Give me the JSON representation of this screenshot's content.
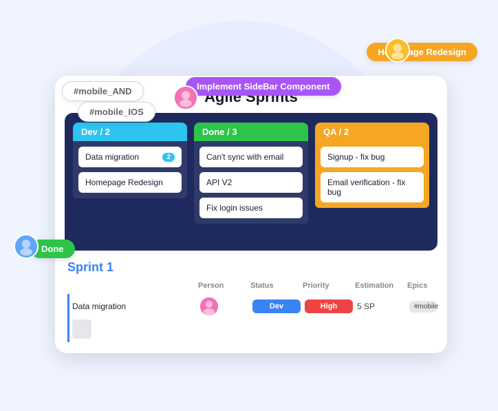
{
  "page": {
    "title": "Agile Sprints"
  },
  "floating_labels": {
    "mobile_and": "#mobile_AND",
    "mobile_ios": "#mobile_IOS",
    "homepage": "Homepage Redesign",
    "sidebar": "Implement SideBar Component",
    "done": "Done"
  },
  "board": {
    "columns": [
      {
        "id": "dev",
        "header": "Dev / 2",
        "type": "dev",
        "cards": [
          {
            "text": "Data migration",
            "badge": "2"
          },
          {
            "text": "Homepage Redesign",
            "badge": null
          }
        ]
      },
      {
        "id": "done",
        "header": "Done / 3",
        "type": "done",
        "cards": [
          {
            "text": "Can't sync with email",
            "badge": null
          },
          {
            "text": "API V2",
            "badge": null
          },
          {
            "text": "Fix login issues",
            "badge": null
          }
        ]
      },
      {
        "id": "qa",
        "header": "QA / 2",
        "type": "qa",
        "cards": [
          {
            "text": "Signup - fix bug",
            "badge": null
          },
          {
            "text": "Email verification - fix bug",
            "badge": null
          }
        ]
      }
    ]
  },
  "sprint": {
    "title": "Sprint 1",
    "headers": [
      "",
      "Person",
      "Status",
      "Priority",
      "Estimation",
      "Epics",
      ""
    ],
    "rows": [
      {
        "name": "Data migration",
        "person_icon": "👤",
        "status": "Dev",
        "priority": "High",
        "estimation": "5 SP",
        "epic": "#mobile"
      }
    ]
  },
  "add_button": "+",
  "scroll_pill": ""
}
